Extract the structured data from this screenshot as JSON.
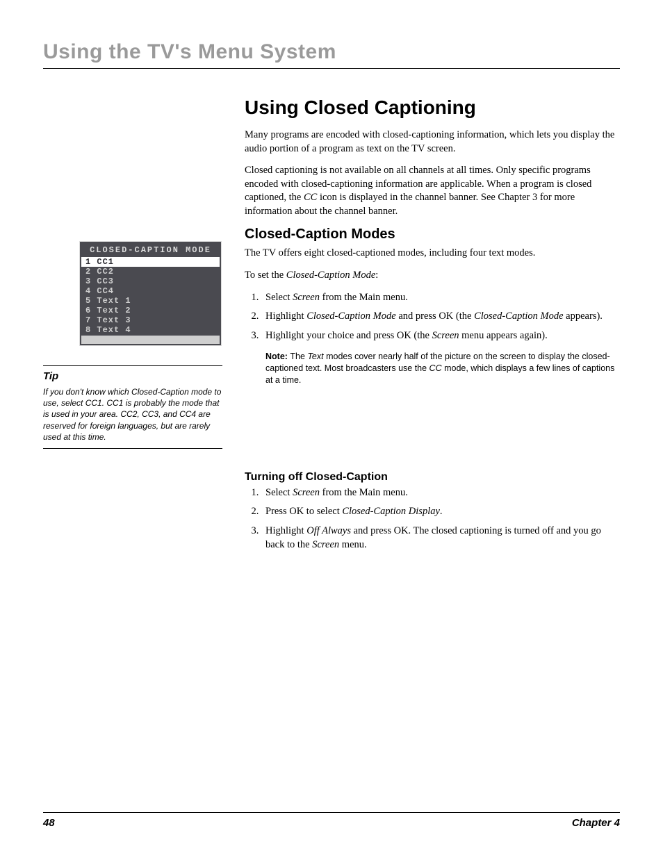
{
  "chapter_header": "Using the TV's Menu System",
  "menu": {
    "title": "CLOSED-CAPTION MODE",
    "items": [
      {
        "num": "1",
        "label": "CC1",
        "selected": true
      },
      {
        "num": "2",
        "label": "CC2",
        "selected": false
      },
      {
        "num": "3",
        "label": "CC3",
        "selected": false
      },
      {
        "num": "4",
        "label": "CC4",
        "selected": false
      },
      {
        "num": "5",
        "label": "Text 1",
        "selected": false
      },
      {
        "num": "6",
        "label": "Text 2",
        "selected": false
      },
      {
        "num": "7",
        "label": "Text 3",
        "selected": false
      },
      {
        "num": "8",
        "label": "Text 4",
        "selected": false
      }
    ]
  },
  "tip": {
    "label": "Tip",
    "text": "If you don't know which Closed-Caption mode to use, select CC1. CC1 is probably the mode that is used in your area. CC2, CC3, and CC4  are reserved for foreign languages, but are rarely used at this time."
  },
  "main": {
    "h1": "Using Closed Captioning",
    "intro_p1": "Many programs are encoded with closed-captioning information, which lets you display the audio portion of a program as text on the TV screen.",
    "intro_p2_a": "Closed captioning is not available on all channels at all times. Only specific programs encoded with closed-captioning information are applicable. When a program is closed captioned, the ",
    "intro_p2_cc": "CC",
    "intro_p2_b": " icon is displayed in the channel banner. See Chapter 3 for more information about the channel banner.",
    "modes": {
      "h2": "Closed-Caption Modes",
      "p1": "The TV offers eight closed-captioned modes, including four text modes.",
      "p2_a": "To set the ",
      "p2_i": "Closed-Caption Mode",
      "p2_b": ":",
      "step1_a": "Select ",
      "step1_i": "Screen",
      "step1_b": " from the Main menu.",
      "step2_a": "Highlight ",
      "step2_i1": "Closed-Caption Mode",
      "step2_b": " and press OK  (the ",
      "step2_i2": "Closed-Caption Mode",
      "step2_c": " appears).",
      "step3_a": "Highlight your choice and press OK (the ",
      "step3_i": "Screen",
      "step3_b": " menu appears again).",
      "note_label": "Note: ",
      "note_a": "The ",
      "note_i1": "Text",
      "note_b": " modes cover nearly half of the picture on the screen to display the closed-captioned text. Most broadcasters use the ",
      "note_i2": "CC",
      "note_c": " mode, which displays a few lines of captions at a time."
    },
    "off": {
      "h3": "Turning off Closed-Caption",
      "step1_a": "Select ",
      "step1_i": "Screen",
      "step1_b": " from the Main menu.",
      "step2_a": "Press OK to select ",
      "step2_i": "Closed-Caption Display",
      "step2_b": ".",
      "step3_a": "Highlight ",
      "step3_i1": "Off Always",
      "step3_b": " and press OK. The closed captioning is turned off and you go back to the ",
      "step3_i2": "Screen",
      "step3_c": " menu."
    }
  },
  "footer": {
    "page": "48",
    "chapter": "Chapter 4"
  }
}
